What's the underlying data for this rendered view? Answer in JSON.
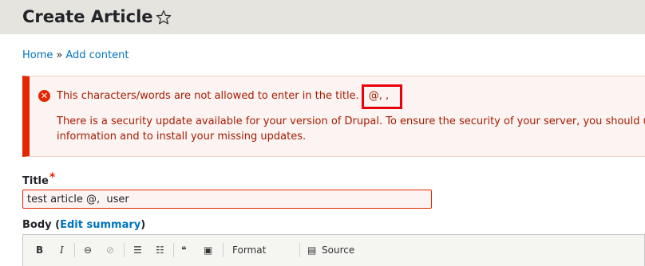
{
  "header": {
    "title": "Create Article"
  },
  "breadcrumb": {
    "home": "Home",
    "separator": "»",
    "current": "Add content"
  },
  "messages": {
    "error_text": "This characters/words are not allowed to enter in the title.",
    "error_chars": "@, ,",
    "update_line1": "There is a security update available for your version of Drupal. To ensure the security of your server, you should u",
    "update_line2": "information and to install your missing updates."
  },
  "form": {
    "title_label": "Title",
    "required_mark": "*",
    "title_value": "test article @,  user",
    "body_label": "Body",
    "edit_summary_open": "(",
    "edit_summary": "Edit summary",
    "edit_summary_close": ")"
  },
  "toolbar": {
    "bold": "B",
    "italic": "I",
    "format": "Format",
    "source": "Source"
  },
  "colors": {
    "error": "#e62600",
    "link": "#0074bd",
    "header_bg": "#e6e4df"
  }
}
